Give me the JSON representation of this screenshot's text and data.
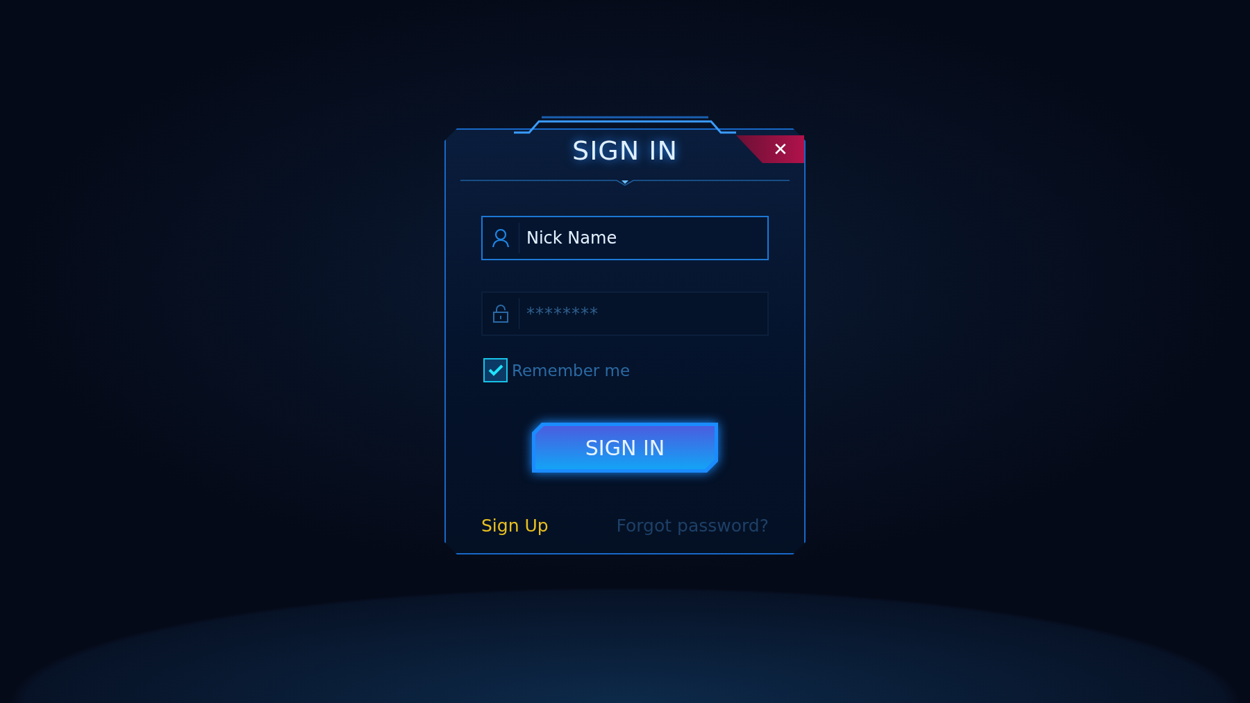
{
  "dialog": {
    "title": "SIGN IN",
    "close": "✕"
  },
  "fields": [
    {
      "kind": "user",
      "value": "Nick Name",
      "focused": true
    },
    {
      "kind": "password",
      "placeholder": "********",
      "focused": false
    }
  ],
  "remember": {
    "label": "Remember me",
    "checked": true
  },
  "submit": {
    "label": "SIGN IN"
  },
  "links": [
    {
      "label": "Sign Up",
      "kind": "primary"
    },
    {
      "label": "Forgot password?",
      "kind": "muted"
    }
  ]
}
